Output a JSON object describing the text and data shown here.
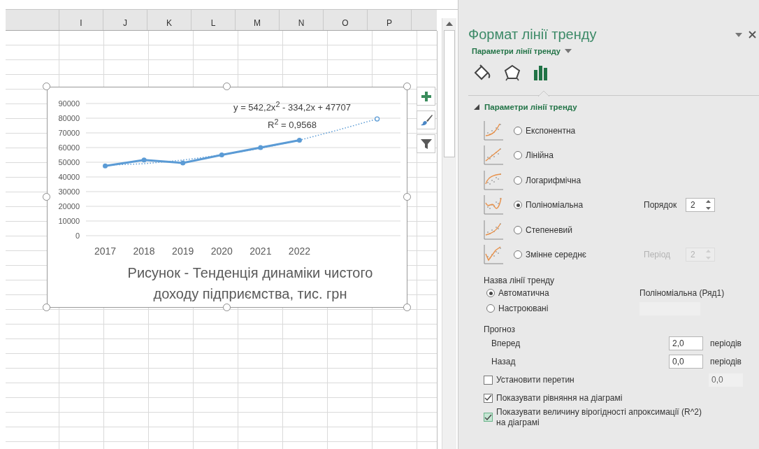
{
  "sheet": {
    "columns": [
      "I",
      "J",
      "K",
      "L",
      "M",
      "N",
      "O",
      "P"
    ]
  },
  "chart": {
    "chart_data": {
      "type": "line",
      "title": "Рисунок - Тенденція динаміки чистого доходу підприємства, тис. грн",
      "x": [
        2017,
        2018,
        2019,
        2020,
        2021,
        2022,
        2023,
        2024
      ],
      "xlim": [
        2014.4,
        2025.5
      ],
      "xticks": [
        2017,
        2018,
        2019,
        2020,
        2021,
        2022
      ],
      "grid": true,
      "series": [
        {
          "color": "#5b9bd5",
          "marker": "circle",
          "line_style": "solid",
          "values": [
            47500,
            51500,
            49500,
            55000,
            60000,
            65000,
            null,
            null
          ]
        },
        {
          "color": "#5b9bd5",
          "line_style": "dotted",
          "values": [
            48000,
            49000,
            51500,
            55000,
            59500,
            65000,
            72000,
            79500
          ]
        }
      ],
      "ylim": [
        0,
        90000
      ],
      "yticks": [
        0,
        10000,
        20000,
        30000,
        40000,
        50000,
        60000,
        70000,
        80000,
        90000
      ],
      "annotations": [
        "y = 542,2x$^{2}$ - 334,2x + 47707",
        "R$^{2}$ = 0,9568"
      ]
    }
  },
  "pane": {
    "title": "Формат лінії тренду",
    "subtitle": "Параметри лінії тренду",
    "tabs": [
      {
        "kind": "fill",
        "selected": false
      },
      {
        "kind": "effects",
        "selected": false
      },
      {
        "kind": "options",
        "selected": true
      }
    ],
    "section": {
      "title": "Параметри лінії тренду",
      "expanded": true
    },
    "trend_types": [
      {
        "kind": "exponential",
        "label": "Експонентна",
        "selected": false
      },
      {
        "kind": "linear",
        "label": "Лінійна",
        "selected": false
      },
      {
        "kind": "logarithmic",
        "label": "Логарифмічна",
        "selected": false
      },
      {
        "kind": "polynomial",
        "label": "Поліноміальна",
        "selected": true,
        "param": {
          "label": "Порядок",
          "value": "2",
          "disabled": false
        }
      },
      {
        "kind": "power",
        "label": "Степеневий",
        "selected": false
      },
      {
        "kind": "moving_average",
        "label": "Змінне середнє",
        "selected": false,
        "param": {
          "label": "Період",
          "value": "2",
          "disabled": true
        }
      }
    ],
    "name_label": "Назва лінії тренду",
    "name_options": [
      {
        "label": "Автоматична",
        "selected": true,
        "value": "Поліноміальна (Ряд1)"
      },
      {
        "label": "Настроювані",
        "selected": false
      }
    ],
    "forecast": {
      "label": "Прогноз",
      "fields": [
        {
          "label": "Вперед",
          "value": "2,0",
          "unit": "періодів"
        },
        {
          "label": "Назад",
          "value": "0,0",
          "unit": "періодів"
        }
      ]
    },
    "checks": [
      {
        "label": "Установити перетин",
        "checked": false,
        "focused": false,
        "value": "0,0"
      },
      {
        "label": "Показувати рівняння на діаграмі",
        "checked": true,
        "focused": false
      },
      {
        "label": "Показувати величину вірогідності апроксимації (R^2) на діаграмі",
        "checked": true,
        "focused": true
      }
    ]
  }
}
